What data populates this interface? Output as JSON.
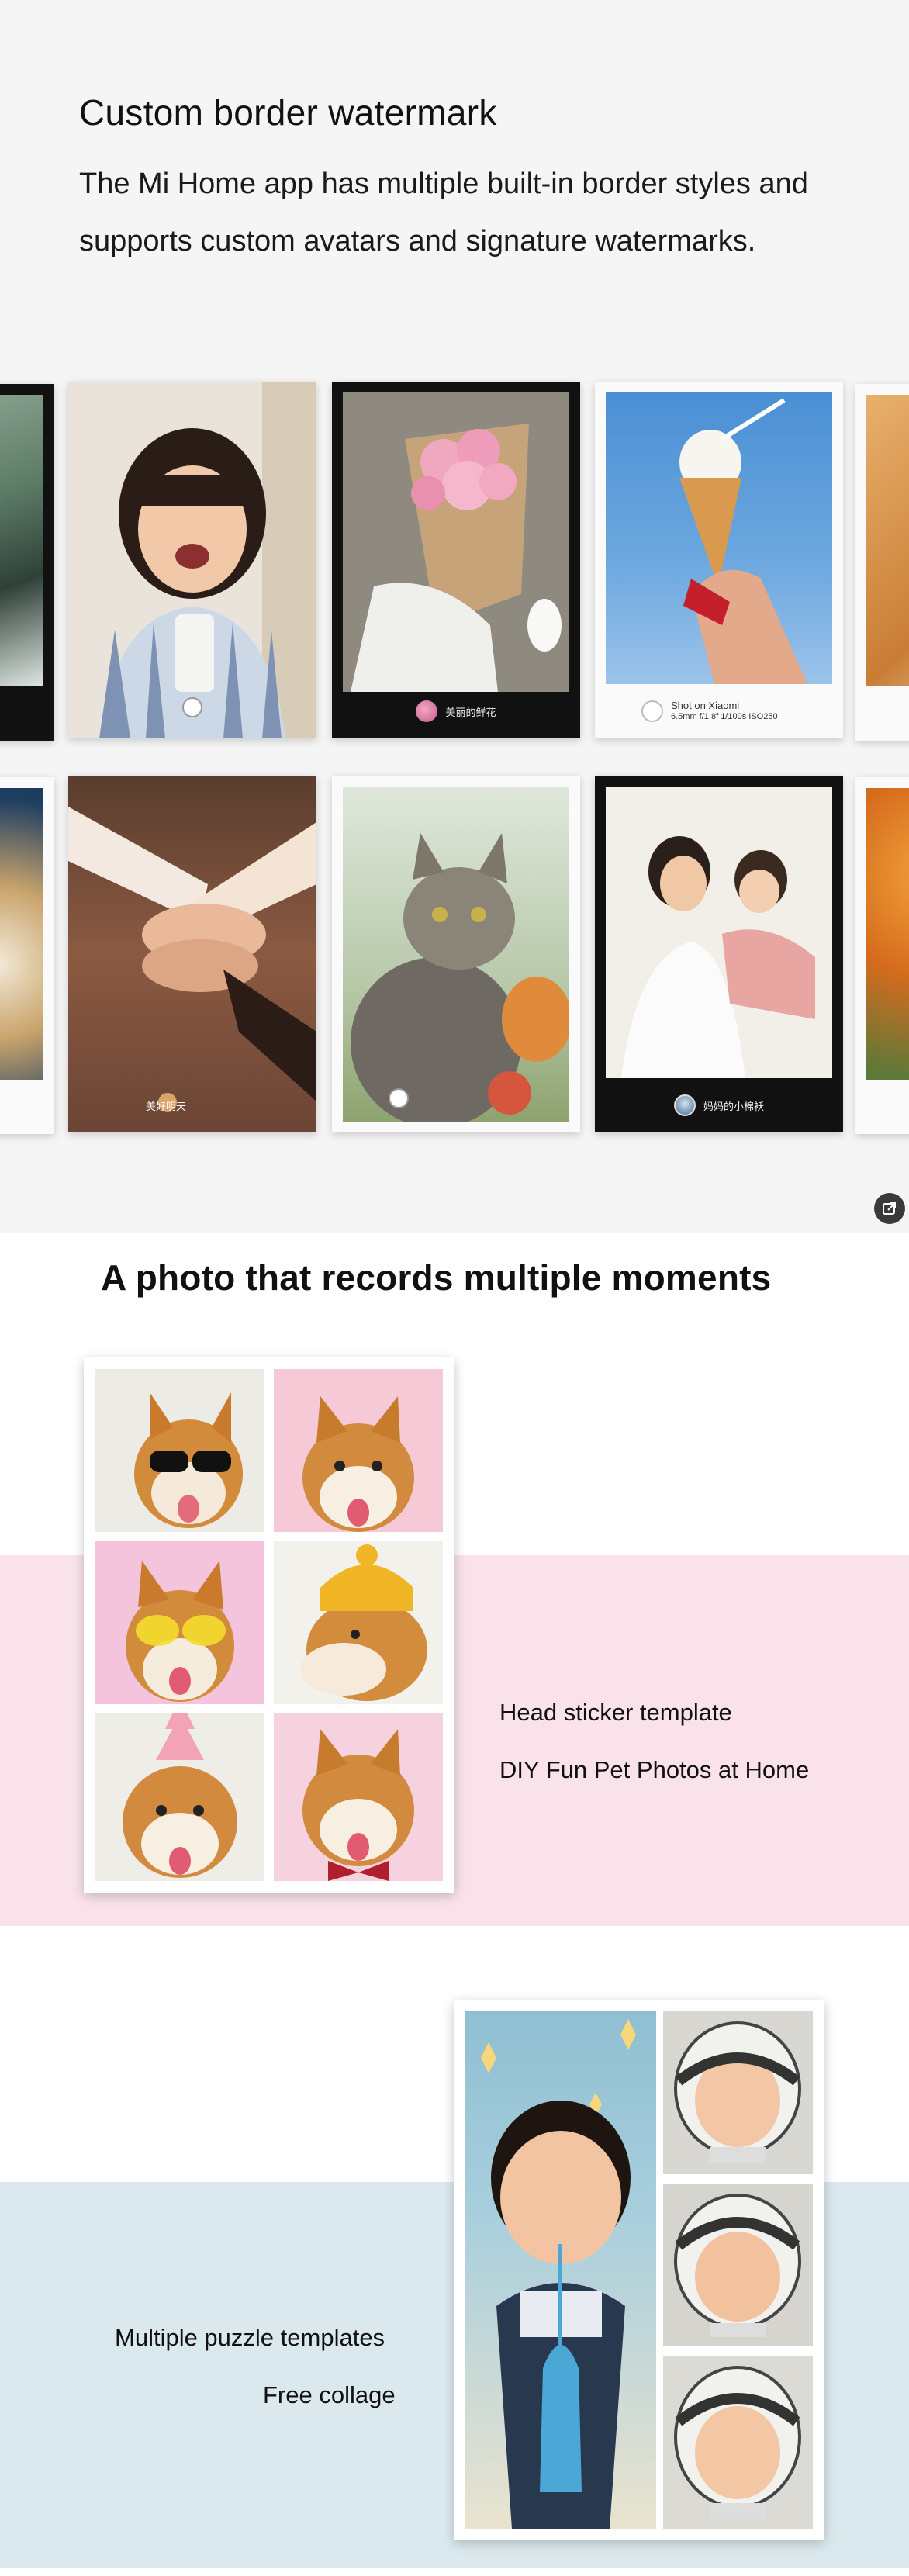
{
  "section_watermark": {
    "title": "Custom border watermark",
    "description": "The Mi Home app has multiple built-in border styles and supports custom avatars and signature watermarks.",
    "cards": [
      {
        "style": "white",
        "caption": "",
        "subcaption": "",
        "badge": "mi-icon"
      },
      {
        "style": "black",
        "caption": "美丽的鲜花",
        "subcaption": "",
        "badge": "flower-avatar"
      },
      {
        "style": "white",
        "caption": "Shot on Xiaomi",
        "subcaption": "6.5mm f/1.8f 1/100s ISO250",
        "badge": "mi-icon"
      },
      {
        "style": "white",
        "caption": "美好明天",
        "subcaption": "",
        "badge": "sun-avatar"
      },
      {
        "style": "white",
        "caption": "",
        "subcaption": "",
        "badge": "mi-icon"
      },
      {
        "style": "black",
        "caption": "妈妈的小棉袄",
        "subcaption": "",
        "badge": "face-avatar"
      }
    ]
  },
  "section_moments": {
    "title": "A photo that records multiple moments",
    "head_sticker_label": "Head sticker template",
    "diy_label": "DIY Fun Pet Photos at Home",
    "puzzle_label": "Multiple puzzle templates",
    "collage_label": "Free collage"
  },
  "colors": {
    "top_bg": "#f5f5f5",
    "pink_band": "#f9e2ea",
    "blue_band": "#dbe9ee"
  },
  "icons": [
    "share-icon",
    "mi-logo-icon"
  ]
}
